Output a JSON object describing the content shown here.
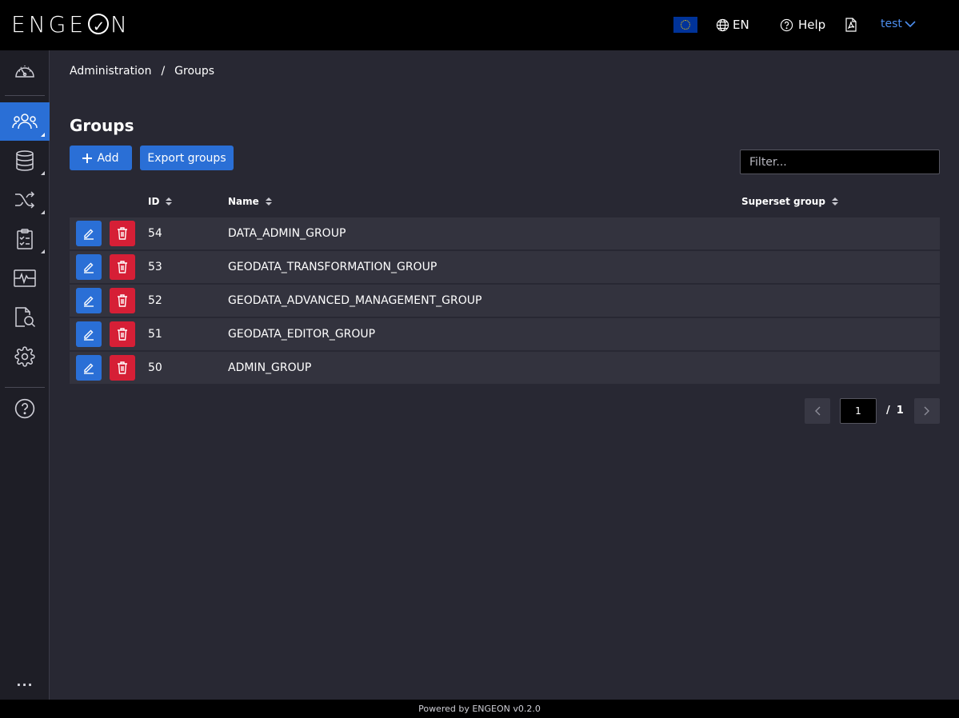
{
  "app": {
    "logo_text": "ENGEON",
    "footer": "Powered by ENGEON v0.2.0"
  },
  "header": {
    "language": "EN",
    "help_label": "Help",
    "user_label": "test"
  },
  "sidebar": {
    "items": [
      {
        "name": "dashboard",
        "icon": "speedometer-icon"
      },
      {
        "name": "groups",
        "icon": "users-icon",
        "active": true
      },
      {
        "name": "database",
        "icon": "database-icon"
      },
      {
        "name": "transformations",
        "icon": "shuffle-icon"
      },
      {
        "name": "tasks",
        "icon": "clipboard-checklist-icon"
      },
      {
        "name": "monitoring",
        "icon": "activity-icon"
      },
      {
        "name": "search",
        "icon": "document-search-icon"
      },
      {
        "name": "settings",
        "icon": "gear-icon"
      },
      {
        "name": "help",
        "icon": "question-circle-icon"
      }
    ],
    "more_label": "..."
  },
  "breadcrumb": {
    "parent": "Administration",
    "separator": "/",
    "current": "Groups"
  },
  "page": {
    "title": "Groups",
    "add_label": "Add",
    "export_label": "Export groups",
    "filter_placeholder": "Filter..."
  },
  "table": {
    "columns": [
      "ID",
      "Name",
      "Superset group"
    ],
    "rows": [
      {
        "id": "54",
        "name": "DATA_ADMIN_GROUP",
        "superset": ""
      },
      {
        "id": "53",
        "name": "GEODATA_TRANSFORMATION_GROUP",
        "superset": ""
      },
      {
        "id": "52",
        "name": "GEODATA_ADVANCED_MANAGEMENT_GROUP",
        "superset": ""
      },
      {
        "id": "51",
        "name": "GEODATA_EDITOR_GROUP",
        "superset": ""
      },
      {
        "id": "50",
        "name": "ADMIN_GROUP",
        "superset": ""
      }
    ]
  },
  "pagination": {
    "current_page": "1",
    "separator": "/",
    "total_pages": "1"
  },
  "colors": {
    "accent": "#2a6fd6",
    "danger": "#d61f36",
    "background": "#282833",
    "row": "#33333e",
    "user_link": "#4d8ff0"
  }
}
